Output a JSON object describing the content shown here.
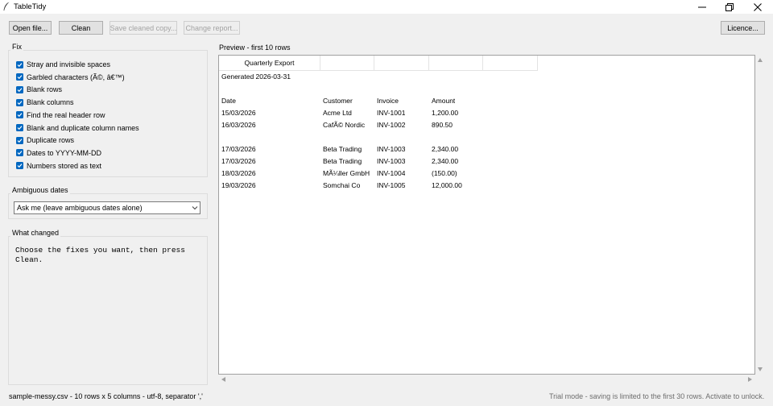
{
  "window": {
    "title": "TableTidy"
  },
  "toolbar": {
    "open_label": "Open file...",
    "clean_label": "Clean",
    "save_label": "Save cleaned copy...",
    "report_label": "Change report...",
    "licence_label": "Licence..."
  },
  "fix": {
    "label": "Fix",
    "items": [
      {
        "label": "Stray and invisible spaces",
        "checked": true
      },
      {
        "label": "Garbled characters (Ã©, â€™)",
        "checked": true
      },
      {
        "label": "Blank rows",
        "checked": true
      },
      {
        "label": "Blank columns",
        "checked": true
      },
      {
        "label": "Find the real header row",
        "checked": true
      },
      {
        "label": "Blank and duplicate column names",
        "checked": true
      },
      {
        "label": "Duplicate rows",
        "checked": true
      },
      {
        "label": "Dates to YYYY-MM-DD",
        "checked": true
      },
      {
        "label": "Numbers stored as text",
        "checked": true
      }
    ]
  },
  "dates": {
    "label": "Ambiguous dates",
    "selected": "Ask me (leave ambiguous dates alone)"
  },
  "changes": {
    "label": "What changed",
    "text": "Choose the fixes you want, then press\nClean."
  },
  "preview": {
    "label": "Preview - first 10 rows",
    "header_cells": [
      "Quarterly Export",
      "",
      "",
      "",
      ""
    ],
    "rows": [
      [
        "Generated 2026-03-31",
        "",
        "",
        ""
      ],
      [
        "",
        "",
        "",
        ""
      ],
      [
        "Date",
        "Customer",
        "Invoice",
        "Amount"
      ],
      [
        "15/03/2026",
        " Acme Ltd",
        "INV-1001",
        "1,200.00"
      ],
      [
        "16/03/2026",
        "CafÃ© Nordic",
        "INV-1002",
        "890.50"
      ],
      [
        "",
        "",
        "",
        ""
      ],
      [
        "17/03/2026",
        "Beta Trading",
        "INV-1003",
        "2,340.00"
      ],
      [
        "17/03/2026",
        "Beta Trading",
        "INV-1003",
        "2,340.00"
      ],
      [
        "18/03/2026",
        "MÃ¼ller GmbH",
        "INV-1004",
        "(150.00)"
      ],
      [
        "19/03/2026",
        "Somchai Co",
        "INV-1005",
        "12,000.00"
      ]
    ]
  },
  "status": {
    "left": "sample-messy.csv - 10 rows x 5 columns - utf-8, separator ','",
    "right": "Trial mode - saving is limited to the first 30 rows. Activate to unlock."
  }
}
